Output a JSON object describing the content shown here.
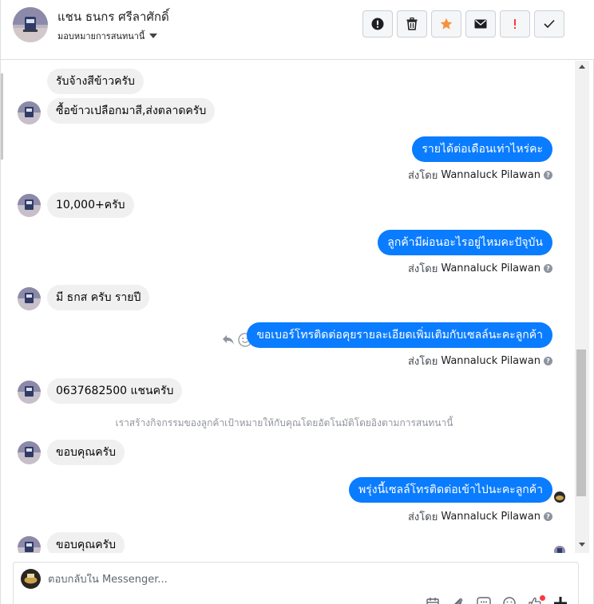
{
  "header": {
    "contact_name": "แชน ธนกร ศรีลาศักดิ์",
    "assign_label": "มอบหมายการสนทนานี้",
    "actions": [
      {
        "name": "spam-button",
        "icon": "exclamation-circle-icon"
      },
      {
        "name": "delete-button",
        "icon": "trash-icon"
      },
      {
        "name": "star-button",
        "icon": "star-icon",
        "color": "#f7923a"
      },
      {
        "name": "mark-unread-button",
        "icon": "envelope-icon"
      },
      {
        "name": "important-button",
        "icon": "exclamation-icon",
        "color": "#fa383e"
      },
      {
        "name": "done-button",
        "icon": "checkmark-icon"
      }
    ]
  },
  "colors": {
    "outgoing_bubble": "#0a7cff",
    "incoming_bubble": "#f0f0f0",
    "star": "#f7923a",
    "alert": "#fa383e"
  },
  "messages": [
    {
      "dir": "in",
      "text": "รับจ้างสีข้าวครับ",
      "avatar": false
    },
    {
      "dir": "in",
      "text": "ซื้อข้าวเปลือกมาสี,ส่งตลาดครับ",
      "avatar": true
    },
    {
      "dir": "out",
      "text": "รายได้ต่อเดือนเท่าไหร่คะ",
      "sent_by_label": "ส่งโดย",
      "sent_by": "Wannaluck Pilawan"
    },
    {
      "dir": "in",
      "text": "10,000+ครับ",
      "avatar": true
    },
    {
      "dir": "out",
      "text": "ลูกค้ามีผ่อนอะไรอยู่ไหมคะปัจุบัน",
      "sent_by_label": "ส่งโดย",
      "sent_by": "Wannaluck Pilawan"
    },
    {
      "dir": "in",
      "text": "มี ธกส ครับ รายปี",
      "avatar": true
    },
    {
      "dir": "out",
      "text": "ขอเบอร์โทรติดต่อคุยรายละเอียดเพิ่มเติมกับเซลล์นะคะลูกค้า",
      "sent_by_label": "ส่งโดย",
      "sent_by": "Wannaluck Pilawan"
    },
    {
      "dir": "in",
      "text": "0637682500 แชนครับ",
      "avatar": true
    },
    {
      "dir": "system",
      "text": "เราสร้างกิจกรรมของลูกค้าเป้าหมายให้กับคุณโดยอัตโนมัติโดยอิงตามการสนทนานี้"
    },
    {
      "dir": "in",
      "text": "ขอบคุณครับ",
      "avatar": true
    },
    {
      "dir": "out",
      "text": "พรุ่งนี้เซลล์โทรติดต่อเข้าไปนะคะลูกค้า",
      "sent_by_label": "ส่งโดย",
      "sent_by": "Wannaluck Pilawan"
    },
    {
      "dir": "in",
      "text": "ขอบคุณครับ",
      "avatar": true
    }
  ],
  "composer": {
    "placeholder": "ตอบกลับใน Messenger...",
    "tools": [
      "calendar-icon",
      "paperclip-icon",
      "saved-reply-icon",
      "emoji-icon",
      "thumbs-up-icon",
      "add-icon"
    ]
  }
}
